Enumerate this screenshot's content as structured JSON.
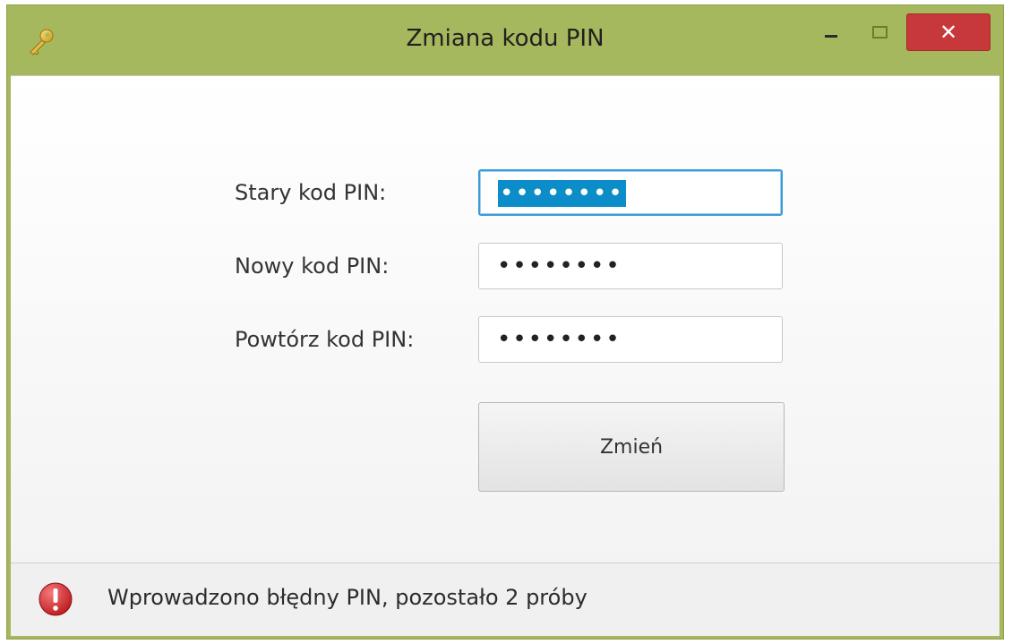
{
  "window": {
    "title": "Zmiana kodu PIN",
    "icon": "key-icon",
    "controls": {
      "minimize": "minimize-icon",
      "maximize": "maximize-icon",
      "close_label": "✕"
    }
  },
  "form": {
    "old_pin": {
      "label": "Stary kod PIN:",
      "value": "••••••••"
    },
    "new_pin": {
      "label": "Nowy kod PIN:",
      "value": "••••••••"
    },
    "repeat_pin": {
      "label": "Powtórz kod PIN:",
      "value": "••••••••"
    },
    "submit_label": "Zmień"
  },
  "status": {
    "icon": "error-icon",
    "message": "Wprowadzono błędny PIN, pozostało 2 próby"
  },
  "colors": {
    "titlebar": "#a6b85e",
    "close": "#c7383b",
    "selection": "#0a8dc8",
    "focus_border": "#3b9bd6",
    "error": "#d8282b"
  }
}
